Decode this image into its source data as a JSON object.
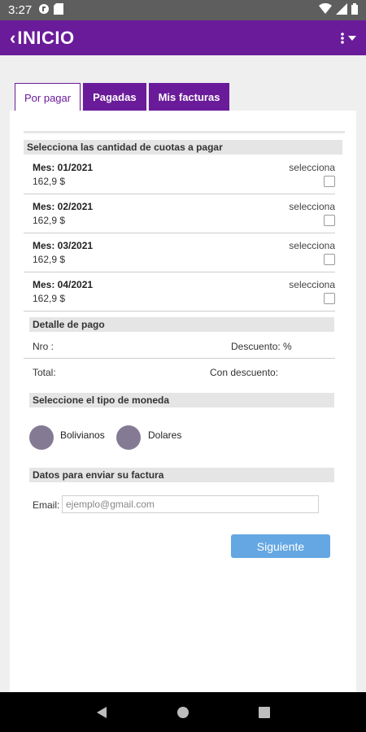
{
  "status_bar": {
    "time": "3:27"
  },
  "app_bar": {
    "title": "INICIO"
  },
  "tabs": [
    {
      "label": "Por pagar",
      "active": true
    },
    {
      "label": "Pagadas",
      "active": false
    },
    {
      "label": "Mis facturas",
      "active": false
    }
  ],
  "cuotas": {
    "header": "Selecciona las cantidad de cuotas a pagar",
    "select_label": "selecciona",
    "items": [
      {
        "mes": "Mes: 01/2021",
        "monto": "162,9 $"
      },
      {
        "mes": "Mes: 02/2021",
        "monto": "162,9 $"
      },
      {
        "mes": "Mes: 03/2021",
        "monto": "162,9 $"
      },
      {
        "mes": "Mes: 04/2021",
        "monto": "162,9 $"
      }
    ]
  },
  "detalle": {
    "header": "Detalle de pago",
    "nro": "Nro :",
    "descuento": "Descuento: %",
    "total": "Total:",
    "con_descuento": "Con descuento:"
  },
  "moneda": {
    "header": "Seleccione el tipo de moneda",
    "options": [
      "Bolivianos",
      "Dolares"
    ],
    "radio_color": "#857a93"
  },
  "factura": {
    "header": "Datos para enviar su factura",
    "email_label": "Email:",
    "email_placeholder": "ejemplo@gmail.com"
  },
  "buttons": {
    "next": "Siguiente"
  },
  "colors": {
    "primary": "#6a1b9a",
    "button": "#64a7e2"
  }
}
